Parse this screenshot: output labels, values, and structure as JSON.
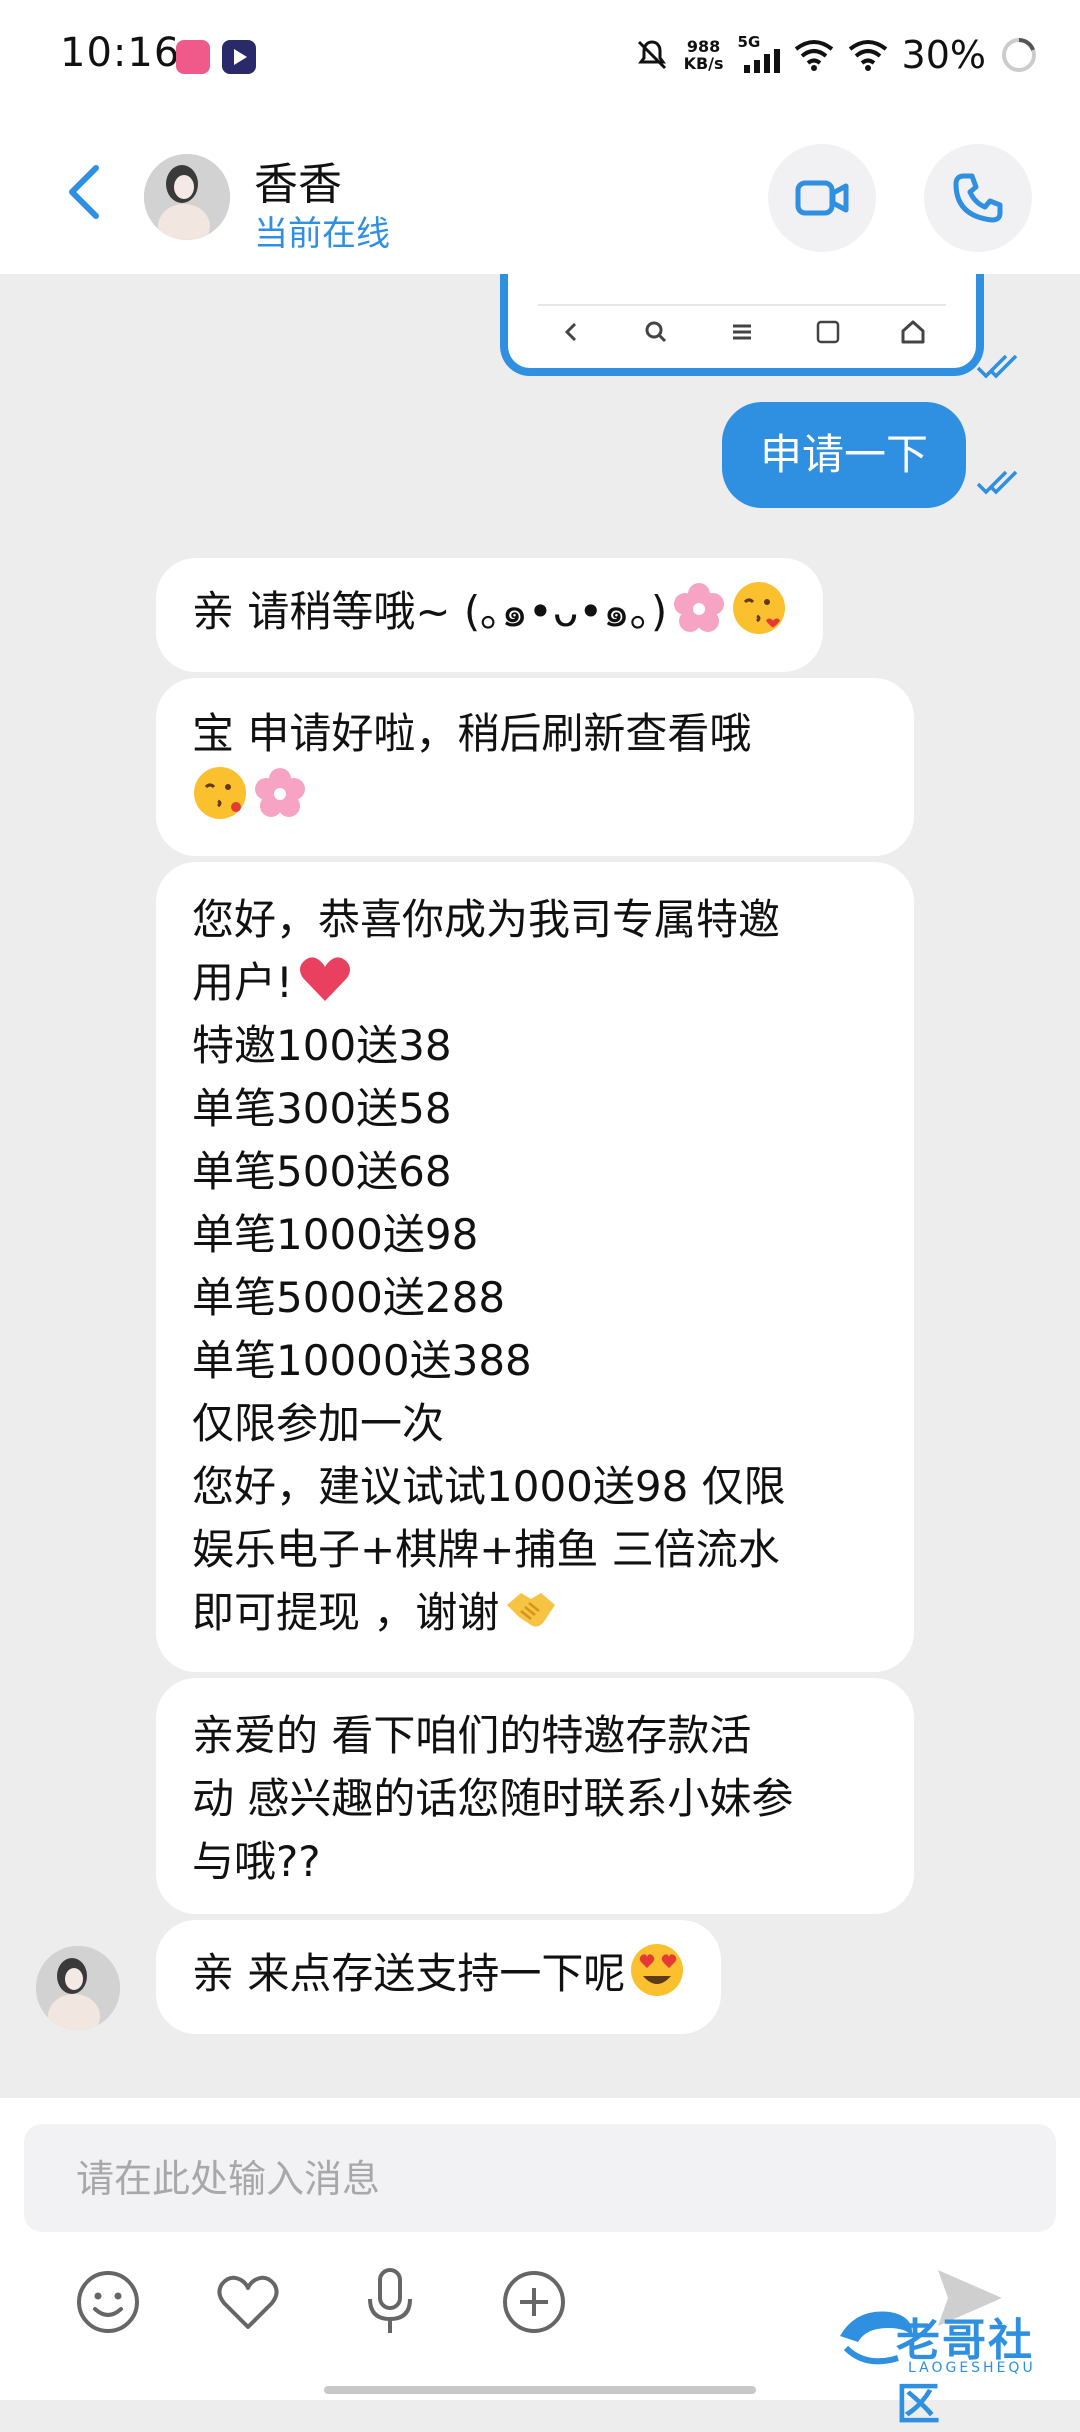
{
  "status_bar": {
    "time": "10:16",
    "net_speed_value": "988",
    "net_speed_unit": "KB/s",
    "network": "5G",
    "battery": "30%"
  },
  "header": {
    "contact_name": "香香",
    "contact_status": "当前在线"
  },
  "messages": [
    {
      "sender": "me",
      "text": "申请一下"
    },
    {
      "sender": "contact",
      "text": "亲  请稍等哦~ (｡๑•ᴗ•๑｡)"
    },
    {
      "sender": "contact",
      "text": "宝  申请好啦，稍后刷新查看哦"
    },
    {
      "sender": "contact",
      "lines": [
        "您好，恭喜你成为我司专属特邀",
        "用户!",
        "特邀100送38",
        "单笔300送58",
        "单笔500送68",
        "单笔1000送98",
        "单笔5000送288",
        "单笔10000送388",
        "仅限参加一次",
        "您好，建议试试1000送98  仅限",
        "娱乐电子+棋牌+捕鱼 三倍流水",
        "即可提现 ，谢谢"
      ]
    },
    {
      "sender": "contact",
      "lines": [
        "亲爱的  看下咱们的特邀存款活",
        "动 感兴趣的话您随时联系小妹参",
        "与哦??"
      ]
    },
    {
      "sender": "contact",
      "text": "亲 来点存送支持一下呢"
    }
  ],
  "input": {
    "placeholder": "请在此处输入消息"
  },
  "watermark": {
    "text": "老哥社区",
    "subtext": "LAOGESHEQU"
  },
  "colors": {
    "accent": "#2f8fe0",
    "chat_bg": "#ededed",
    "bubble_in": "#ffffff",
    "bubble_out": "#2f8fe0"
  },
  "icons": [
    "back-arrow-icon",
    "video-call-icon",
    "phone-icon",
    "emoji-icon",
    "heart-icon",
    "microphone-icon",
    "plus-icon",
    "send-icon"
  ]
}
